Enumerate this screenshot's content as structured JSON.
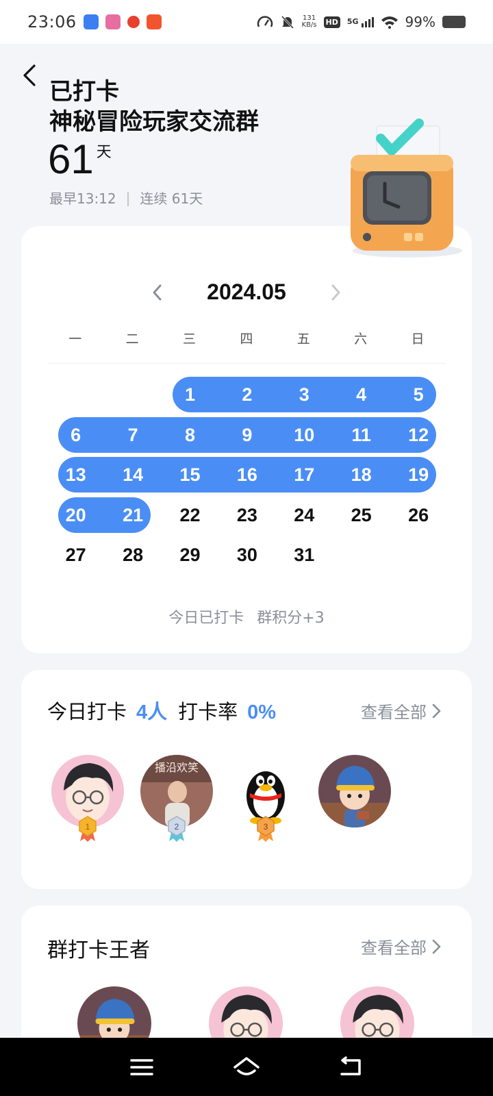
{
  "status_bar": {
    "time": "23:06",
    "net_speed_value": "131",
    "net_speed_unit": "KB/s",
    "hd": "HD",
    "signal": "5G",
    "battery": "99%"
  },
  "header": {
    "title": "已打卡",
    "group_name": "神秘冒险玩家交流群",
    "days": "61",
    "days_unit": "天",
    "earliest": "最早13:12",
    "separator": "|",
    "streak": "连续 61天"
  },
  "calendar": {
    "month": "2024.05",
    "weekdays": [
      "一",
      "二",
      "三",
      "四",
      "五",
      "六",
      "日"
    ],
    "days": [
      "1",
      "2",
      "3",
      "4",
      "5",
      "6",
      "7",
      "8",
      "9",
      "10",
      "11",
      "12",
      "13",
      "14",
      "15",
      "16",
      "17",
      "18",
      "19",
      "20",
      "21",
      "22",
      "23",
      "24",
      "25",
      "26",
      "27",
      "28",
      "29",
      "30",
      "31"
    ],
    "checked_days": [
      "1",
      "2",
      "3",
      "4",
      "5",
      "6",
      "7",
      "8",
      "9",
      "10",
      "11",
      "12",
      "13",
      "14",
      "15",
      "16",
      "17",
      "18",
      "19",
      "20",
      "21"
    ],
    "footer_status": "今日已打卡",
    "footer_points": "群积分+3",
    "accent_color": "#4a8ef5"
  },
  "today": {
    "label1": "今日打卡",
    "count": "4人",
    "label2": "打卡率",
    "rate": "0%",
    "view_all": "查看全部",
    "avatars": [
      {
        "name": "avatar-cartoon-boy-glasses",
        "rank": "1"
      },
      {
        "name": "avatar-photo-child",
        "rank": "2",
        "caption": "播沿欢笑"
      },
      {
        "name": "avatar-qq-penguin",
        "rank": "3"
      },
      {
        "name": "avatar-cartoon-builder",
        "rank": ""
      }
    ]
  },
  "king": {
    "title": "群打卡王者",
    "view_all": "查看全部"
  }
}
